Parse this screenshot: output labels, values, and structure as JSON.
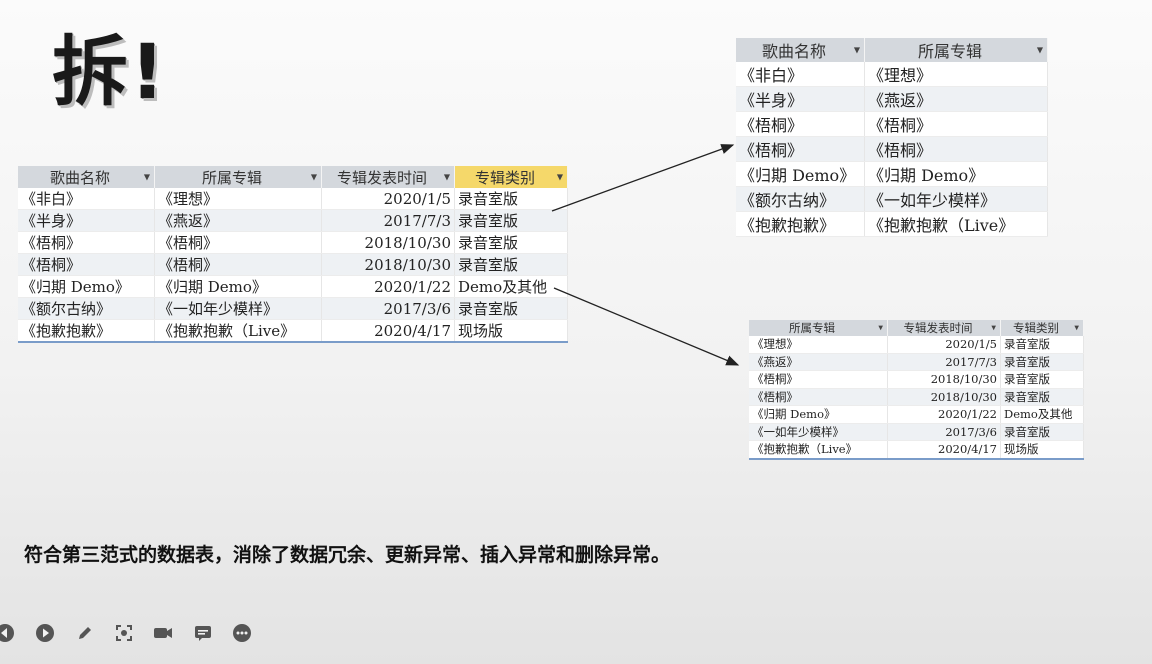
{
  "title": "拆!",
  "caption": "符合第三范式的数据表，消除了数据冗余、更新异常、插入异常和删除异常。",
  "main_table": {
    "headers": [
      "歌曲名称",
      "所属专辑",
      "专辑发表时间",
      "专辑类别"
    ],
    "rows": [
      [
        "《非白》",
        "《理想》",
        "2020/1/5",
        "录音室版"
      ],
      [
        "《半身》",
        "《燕返》",
        "2017/7/3",
        "录音室版"
      ],
      [
        "《梧桐》",
        "《梧桐》",
        "2018/10/30",
        "录音室版"
      ],
      [
        "《梧桐》",
        "《梧桐》",
        "2018/10/30",
        "录音室版"
      ],
      [
        "《归期 Demo》",
        "《归期 Demo》",
        "2020/1/22",
        "Demo及其他"
      ],
      [
        "《额尔古纳》",
        "《一如年少模样》",
        "2017/3/6",
        "录音室版"
      ],
      [
        "《抱歉抱歉》",
        "《抱歉抱歉（Live》",
        "2020/4/17",
        "现场版"
      ]
    ]
  },
  "songs_table": {
    "headers": [
      "歌曲名称",
      "所属专辑"
    ],
    "rows": [
      [
        "《非白》",
        "《理想》"
      ],
      [
        "《半身》",
        "《燕返》"
      ],
      [
        "《梧桐》",
        "《梧桐》"
      ],
      [
        "《梧桐》",
        "《梧桐》"
      ],
      [
        "《归期 Demo》",
        "《归期 Demo》"
      ],
      [
        "《额尔古纳》",
        "《一如年少模样》"
      ],
      [
        "《抱歉抱歉》",
        "《抱歉抱歉（Live》"
      ]
    ]
  },
  "albums_table": {
    "headers": [
      "所属专辑",
      "专辑发表时间",
      "专辑类别"
    ],
    "rows": [
      [
        "《理想》",
        "2020/1/5",
        "录音室版"
      ],
      [
        "《燕返》",
        "2017/7/3",
        "录音室版"
      ],
      [
        "《梧桐》",
        "2018/10/30",
        "录音室版"
      ],
      [
        "《梧桐》",
        "2018/10/30",
        "录音室版"
      ],
      [
        "《归期 Demo》",
        "2020/1/22",
        "Demo及其他"
      ],
      [
        "《一如年少模样》",
        "2017/3/6",
        "录音室版"
      ],
      [
        "《抱歉抱歉（Live》",
        "2020/4/17",
        "现场版"
      ]
    ]
  },
  "toolbar": {
    "icons": [
      "back-icon",
      "play-icon",
      "pen-icon",
      "screenshot-icon",
      "camera-icon",
      "subtitle-icon",
      "more-icon"
    ]
  },
  "colors": {
    "header_bg": "#d4d8dd",
    "highlight_header": "#f5d86a",
    "alt_row": "#eef1f4",
    "table_border_accent": "#7a9cc9"
  }
}
